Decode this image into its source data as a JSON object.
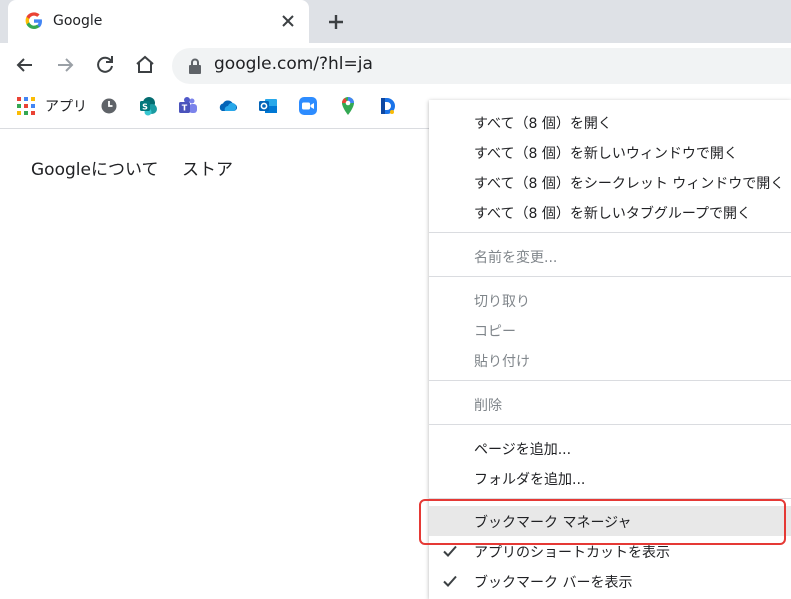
{
  "tab": {
    "title": "Google"
  },
  "address_bar": {
    "url": "google.com/?hl=ja"
  },
  "bookmarks_bar": {
    "apps_label": "アプリ"
  },
  "page": {
    "links": [
      "Googleについて",
      "ストア"
    ]
  },
  "context_menu": {
    "open_all": "すべて（8 個）を開く",
    "open_all_new_window": "すべて（8 個）を新しいウィンドウで開く",
    "open_all_incognito": "すべて（8 個）をシークレット ウィンドウで開く",
    "open_all_tab_group": "すべて（8 個）を新しいタブグループで開く",
    "rename": "名前を変更...",
    "cut": "切り取り",
    "copy": "コピー",
    "paste": "貼り付け",
    "delete": "削除",
    "add_page": "ページを追加...",
    "add_folder": "フォルダを追加...",
    "bookmark_manager": "ブックマーク マネージャ",
    "show_apps_shortcut": "アプリのショートカットを表示",
    "show_bookmarks_bar": "ブックマーク バーを表示"
  },
  "colors": {
    "highlight_border": "#e53935",
    "hover_bg": "#e8e8e8",
    "tabstrip_bg": "#dee1e6"
  }
}
